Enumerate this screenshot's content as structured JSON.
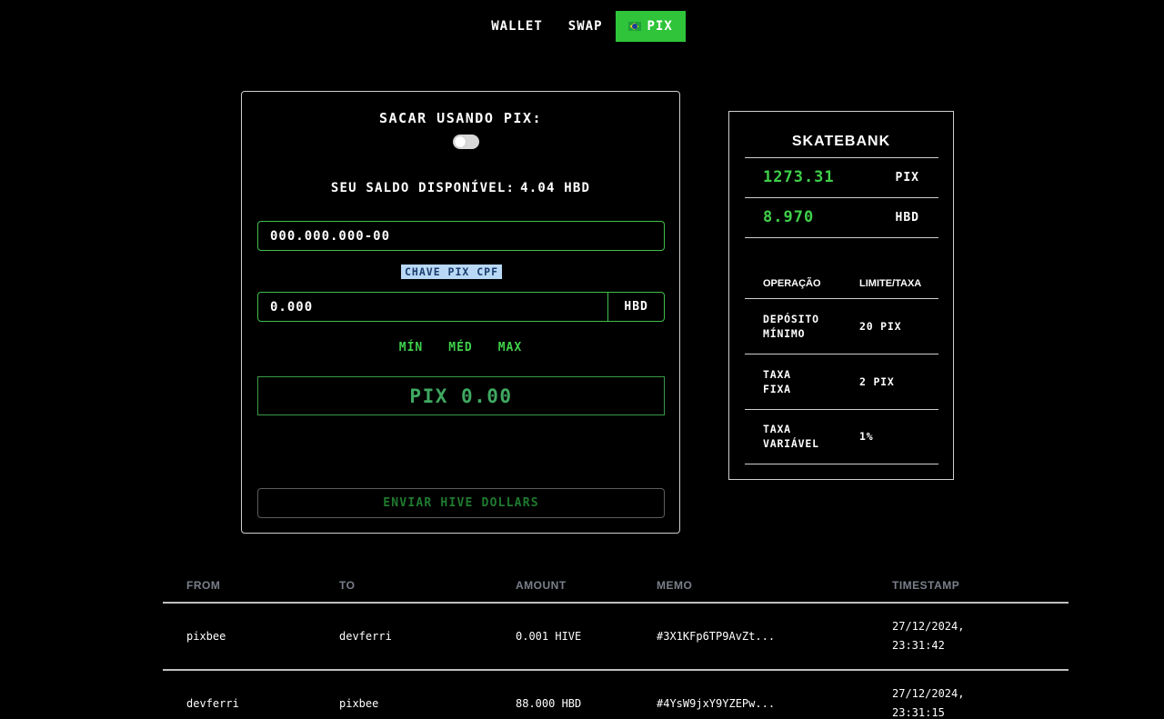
{
  "nav": {
    "items": [
      {
        "label": "WALLET",
        "active": false
      },
      {
        "label": "SWAP",
        "active": false
      },
      {
        "label": "PIX",
        "active": true,
        "icon": "brazil-flag-icon"
      }
    ]
  },
  "withdraw": {
    "title": "SACAR USANDO PIX:",
    "toggle_on": false,
    "balance_label": "SEU SALDO DISPONÍVEL:",
    "balance_value": "4.04 HBD",
    "cpf_placeholder": "000.000.000-00",
    "key_type_badge": "CHAVE PIX CPF",
    "amount_placeholder": "0.000",
    "amount_unit": "HBD",
    "quick_amounts": [
      "MÍN",
      "MÉD",
      "MAX"
    ],
    "pix_total": "PIX 0.00",
    "send_button": "ENVIAR HIVE DOLLARS"
  },
  "skatebank": {
    "title": "SKATEBANK",
    "balances": [
      {
        "amount": "1273.31",
        "currency": "PIX"
      },
      {
        "amount": "8.970",
        "currency": "HBD"
      }
    ],
    "ops_header": {
      "op": "OPERAÇÃO",
      "limit": "LIMITE/TAXA"
    },
    "ops": [
      {
        "name": "DEPÓSITO\nMÍNIMO",
        "value": "20 PIX"
      },
      {
        "name": "TAXA\nFIXA",
        "value": "2 PIX"
      },
      {
        "name": "TAXA\nVARIÁVEL",
        "value": "1%"
      }
    ]
  },
  "transactions": {
    "headers": [
      "FROM",
      "TO",
      "AMOUNT",
      "MEMO",
      "TIMESTAMP"
    ],
    "rows": [
      {
        "from": "pixbee",
        "to": "devferri",
        "amount": "0.001 HIVE",
        "memo": "#3X1KFp6TP9AvZt...",
        "timestamp": "27/12/2024,\n23:31:42"
      },
      {
        "from": "devferri",
        "to": "pixbee",
        "amount": "88.000 HBD",
        "memo": "#4YsW9jxY9YZEPw...",
        "timestamp": "27/12/2024,\n23:31:15"
      }
    ]
  },
  "colors": {
    "accent_green": "#2fc43a",
    "amount_green": "#3fd04a",
    "badge_blue": "#b8d8f5",
    "header_gray": "#7a7f8a"
  }
}
